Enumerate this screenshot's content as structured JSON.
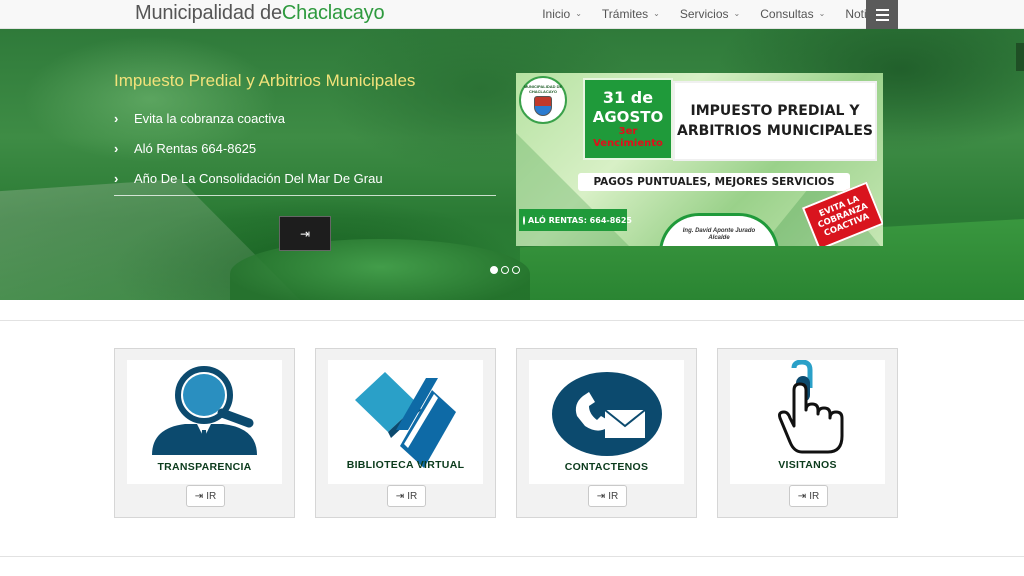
{
  "brand": {
    "prefix": "Municipalidad de",
    "highlight": "Chaclacayo"
  },
  "nav": {
    "items": [
      {
        "label": "Inicio",
        "caret": "⌄"
      },
      {
        "label": "Trámites",
        "caret": "⌄"
      },
      {
        "label": "Servicios",
        "caret": "⌄"
      },
      {
        "label": "Consultas",
        "caret": "⌄"
      },
      {
        "label": "Noticias",
        "caret": ""
      }
    ]
  },
  "hero": {
    "title": "Impuesto Predial y Arbitrios Municipales",
    "bullets": [
      "Evita la cobranza coactiva",
      "Aló Rentas 664-8625",
      "Año De La Consolidación Del Mar De Grau"
    ],
    "button_icon": "⇥",
    "slides_count": 3,
    "active_slide": 1
  },
  "banner": {
    "logo_text": "MUNICIPALIDAD DE CHACLACAYO",
    "date_day": "31 de",
    "date_month": "AGOSTO",
    "due_line1": "3er",
    "due_line2": "Vencimiento",
    "title_line1": "IMPUESTO PREDIAL Y",
    "title_line2": "ARBITRIOS MUNICIPALES",
    "slogan": "PAGOS PUNTUALES, MEJORES SERVICIOS",
    "phone": "ALÓ RENTAS: 664-8625",
    "mayor_name": "Ing. David Aponte Jurado",
    "mayor_role": "Alcalde",
    "stamp_line1": "EVITA LA",
    "stamp_line2": "COBRANZA",
    "stamp_line3": "COACTIVA"
  },
  "cards": [
    {
      "label": "TRANSPARENCIA",
      "icon": "magnifier-person-icon",
      "button": "IR"
    },
    {
      "label": "BIBLIOTECA VIRTUAL",
      "icon": "books-icon",
      "button": "IR"
    },
    {
      "label": "CONTACTENOS",
      "icon": "phone-mail-icon",
      "button": "IR"
    },
    {
      "label": "VISITANOS",
      "icon": "mouse-hand-icon",
      "button": "IR"
    }
  ],
  "colors": {
    "brand_green": "#2e9a3e",
    "card_label": "#0b3b1c",
    "icon_navy": "#0c4a6e",
    "icon_blue": "#0e6aa6",
    "icon_cyan": "#2aa0c8"
  }
}
